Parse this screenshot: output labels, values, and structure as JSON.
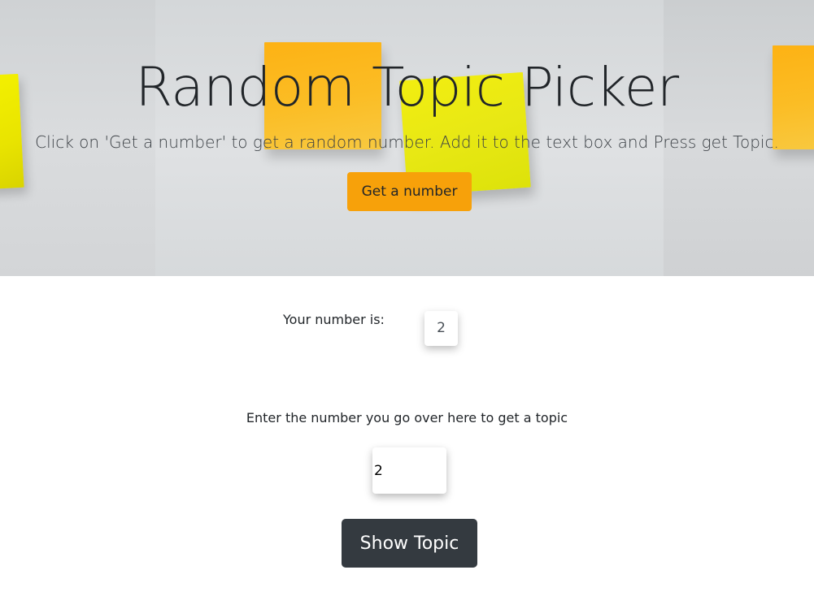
{
  "hero": {
    "title": "Random Topic Picker",
    "lead": "Click on 'Get a number' to get a random number. Add it to the text box and Press get Topic.",
    "get_number_button": "Get a number",
    "button_color": "#f7a10a"
  },
  "result": {
    "label": "Your number is:",
    "number": "2"
  },
  "topic": {
    "instruction": "Enter the number you go over here to get a topic",
    "input_value": "2",
    "show_topic_button": "Show Topic",
    "button_color": "#343a40"
  }
}
